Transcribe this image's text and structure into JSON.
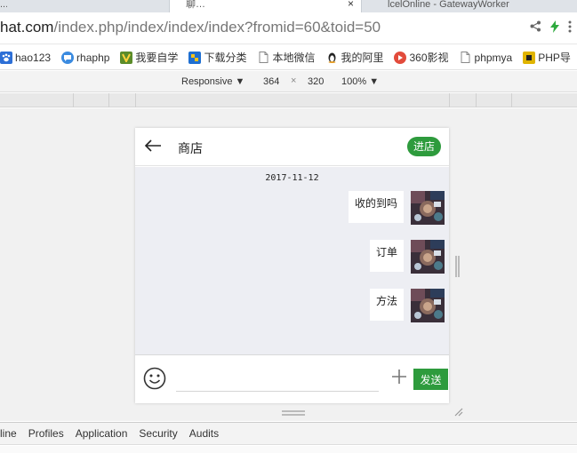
{
  "browser": {
    "tabs": [
      {
        "label": "..."
      },
      {
        "label": "聊…",
        "active": true
      },
      {
        "label": "lcelOnline - GatewayWorker"
      }
    ],
    "tab_close": "×",
    "url_host": "hat.com",
    "url_path": "/index.php/index/index/index?fromid=60&toid=50",
    "bookmarks": [
      {
        "label": "hao123",
        "icon": "paw-icon",
        "color": "#2d6fd6"
      },
      {
        "label": "rhaphp",
        "icon": "chat-bubble-icon",
        "color": "#3b8be0"
      },
      {
        "label": "我要自学",
        "icon": "v-logo-icon",
        "color": "#5b8c2a"
      },
      {
        "label": "下载分类",
        "icon": "download-flag-icon",
        "color": "#1f6fd1"
      },
      {
        "label": "本地微信",
        "icon": "page-icon",
        "color": "#888888"
      },
      {
        "label": "我的阿里",
        "icon": "penguin-icon",
        "color": "#222222"
      },
      {
        "label": "360影视",
        "icon": "play-circle-icon",
        "color": "#e24b3b"
      },
      {
        "label": "phpmya",
        "icon": "page-icon",
        "color": "#888888"
      },
      {
        "label": "PHP导",
        "icon": "yellow-folder-icon",
        "color": "#e0b400"
      }
    ]
  },
  "devtools": {
    "device_mode": "Responsive ▼",
    "width": "364",
    "times": "×",
    "height": "320",
    "zoom": "100% ▼",
    "panel_tabs": [
      "line",
      "Profiles",
      "Application",
      "Security",
      "Audits"
    ]
  },
  "chat": {
    "title": "商店",
    "enter_label": "进店",
    "date": "2017-11-12",
    "messages": [
      {
        "text": "收的到吗"
      },
      {
        "text": "订单"
      },
      {
        "text": "方法"
      }
    ],
    "input_placeholder": "",
    "send_label": "发送"
  },
  "colors": {
    "accent_green": "#2e9b3d",
    "chat_bg": "#edeef3"
  }
}
